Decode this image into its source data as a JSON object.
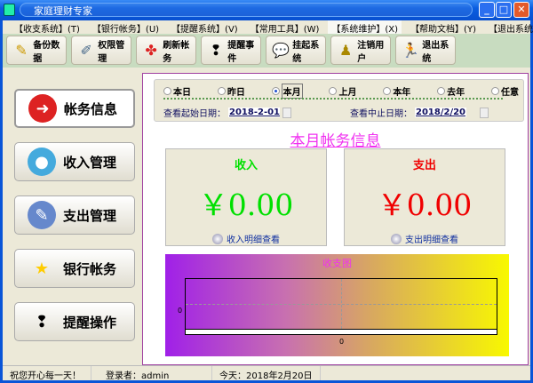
{
  "window": {
    "title": "家庭理财专家"
  },
  "menu": [
    "【收支系统】(T)",
    "【银行帐务】(U)",
    "【提醒系统】(V)",
    "【常用工具】(W)",
    "【系统维护】(X)",
    "【帮助文档】(Y)",
    "【退出系统】(Z)"
  ],
  "toolbar": [
    "备份数据",
    "权限管理",
    "刷新帐务",
    "提醒事件",
    "挂起系统",
    "注销用户",
    "退出系统"
  ],
  "sidebar": [
    "帐务信息",
    "收入管理",
    "支出管理",
    "银行帐务",
    "提醒操作"
  ],
  "filter": {
    "options": [
      "本日",
      "昨日",
      "本月",
      "上月",
      "本年",
      "去年",
      "任意"
    ],
    "selected": "本月",
    "start_label": "查看起始日期：",
    "start_value": "2018-2-01",
    "end_label": "查看中止日期：",
    "end_value": "2018/2/20"
  },
  "page_title": "本月帐务信息",
  "income": {
    "label": "收入",
    "amount": "￥0.00",
    "link": "收入明细查看",
    "color": "#00e000"
  },
  "expense": {
    "label": "支出",
    "amount": "￥0.00",
    "link": "支出明细查看",
    "color": "#f00000"
  },
  "chart_data": {
    "type": "bar",
    "title": "收支图",
    "categories": [
      "0"
    ],
    "values": [
      0
    ],
    "yticks": [
      "0"
    ]
  },
  "status": {
    "greeting": "祝您开心每一天！",
    "user_label": "登录者：",
    "user": "admin",
    "today": "今天：2018年2月20日"
  }
}
